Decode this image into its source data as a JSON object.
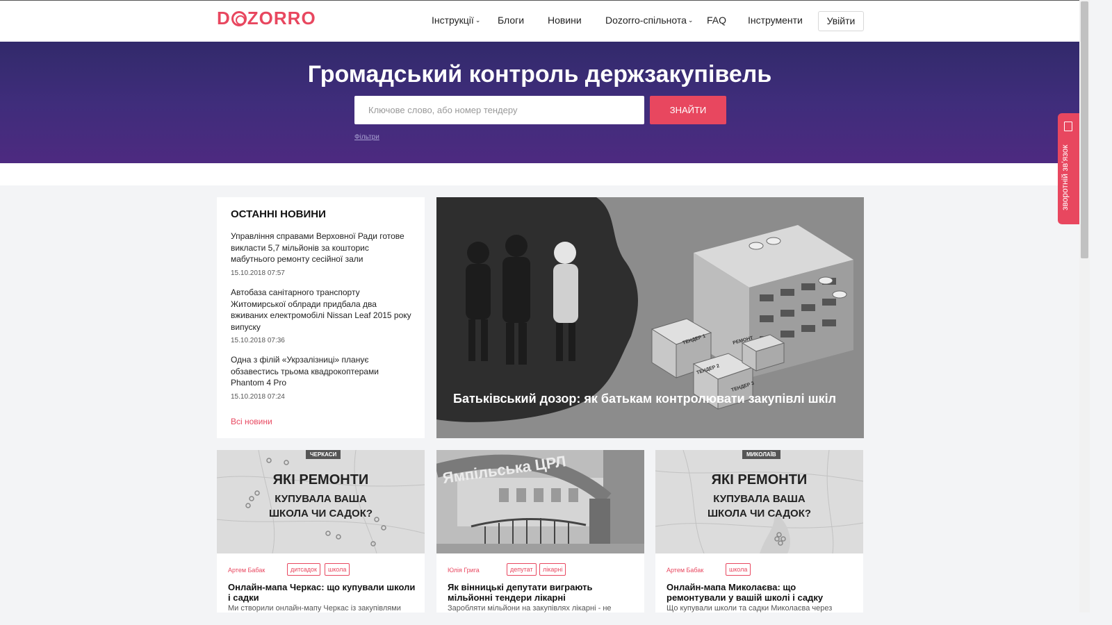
{
  "header": {
    "logo": "DOZORRO",
    "nav": [
      {
        "label": "Інструкції",
        "has_dropdown": true
      },
      {
        "label": "Блоги",
        "has_dropdown": false
      },
      {
        "label": "Новини",
        "has_dropdown": false
      },
      {
        "label": "Dozorro-спільнота",
        "has_dropdown": true
      },
      {
        "label": "FAQ",
        "has_dropdown": false
      },
      {
        "label": "Інструменти",
        "has_dropdown": false
      }
    ],
    "login_label": "Увійти",
    "dropdown_icon": "chevron-down-icon"
  },
  "hero": {
    "title": "Громадський контроль держзакупівель",
    "search_placeholder": "Ключове слово, або номер тендеру",
    "search_button": "ЗНАЙТИ",
    "filters_link": "Фільтри"
  },
  "feedback": {
    "label": "зворотній зв’язок",
    "icon": "document-icon"
  },
  "latest_news": {
    "title": "ОСТАННІ НОВИНИ",
    "items": [
      {
        "text": "Управління справами Верховної Ради готове викласти 5,7 мільйонів за кошторис мабутнього ремонту сесійної зали",
        "date": "15.10.2018 07:57"
      },
      {
        "text": "Автобаза санітарного транспорту Житомирської облради придбала два вживаних електромобілі Nissan Leaf 2015 року випуску",
        "date": "15.10.2018 07:36"
      },
      {
        "text": "Одна з філій «Укрзалізниці» планує обзавестись трьома квадрокоптерами Phantom 4 Pro",
        "date": "15.10.2018 07:24"
      }
    ],
    "all_news_link": "Всі новини"
  },
  "featured": {
    "caption": "Батьківський дозор: як батькам контролювати закупівлі шкіл",
    "illustration_labels": [
      "ТЕНДЕР 1",
      "ТЕНДЕР 2",
      "ТЕНДЕР 3",
      "РЕМОНТ"
    ]
  },
  "cards": [
    {
      "image_tag": "ЧЕРКАСИ",
      "image_heading": "ЯКІ РЕМОНТИ",
      "image_subheading": "КУПУВАЛА ВАША ШКОЛА ЧИ САДОК?",
      "author": "Артем Бабак",
      "tags": [
        "дитсадок",
        "школа"
      ],
      "title": "Онлайн-мапа Черкас: що купували школи і садки",
      "description": "Ми створили онлайн-мапу Черкас із закупівлями"
    },
    {
      "image_sign": "Ямпільська ЦРЛ",
      "author": "Юлія Грига",
      "tags": [
        "депутат",
        "лікарні"
      ],
      "title": "Як вінницькі депутати виграють мільйонні тендери лікарні",
      "description": "Заробляти мільйони на закупівлях лікарні - не"
    },
    {
      "image_tag": "МИКОЛАЇВ",
      "image_heading": "ЯКІ РЕМОНТИ",
      "image_subheading": "КУПУВАЛА ВАША ШКОЛА ЧИ САДОК?",
      "author": "Артем Бабак",
      "tags": [
        "школа"
      ],
      "title": "Онлайн-мапа Миколаєва: що ремонтували у вашій школі і садку",
      "description": "Що купували школи та садки Миколаєва через"
    }
  ]
}
